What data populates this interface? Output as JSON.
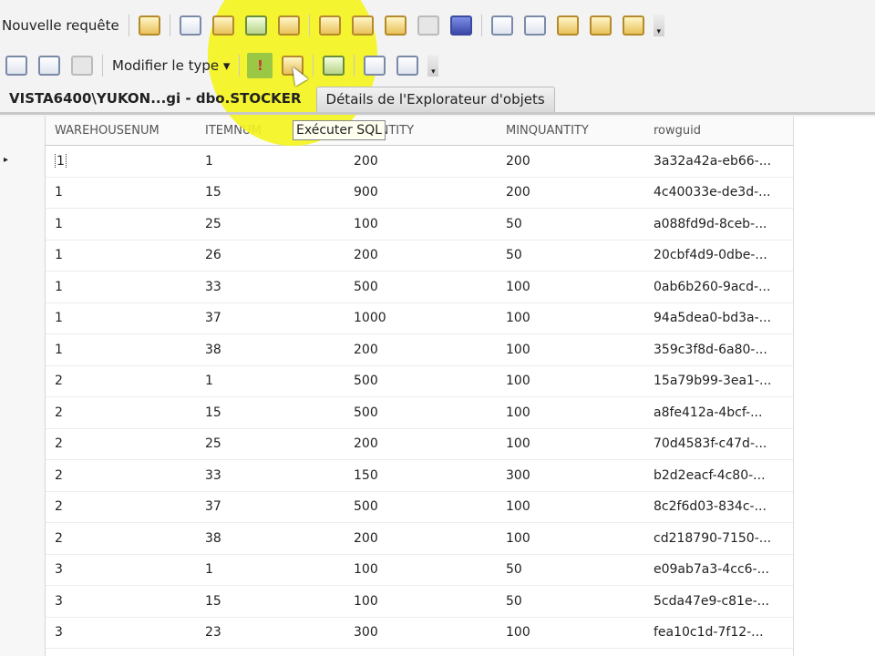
{
  "toolbar1": {
    "new_query_label": "Nouvelle requête",
    "more": "▾"
  },
  "toolbar2": {
    "change_type_label": "Modifier le type ▾",
    "execute_icon": "!",
    "more": "▾"
  },
  "tooltip": "Exécuter SQL",
  "tabs": [
    {
      "label": "VISTA6400\\YUKON...gi - dbo.STOCKER"
    },
    {
      "label": "Détails de l'Explorateur d'objets"
    }
  ],
  "grid": {
    "columns": [
      "WAREHOUSENUM",
      "ITEMNUM",
      "QUANTITY",
      "MINQUANTITY",
      "rowguid"
    ],
    "row_pointer": "▸",
    "rows": [
      [
        "1",
        "1",
        "200",
        "200",
        "3a32a42a-eb66-..."
      ],
      [
        "1",
        "15",
        "900",
        "200",
        "4c40033e-de3d-..."
      ],
      [
        "1",
        "25",
        "100",
        "50",
        "a088fd9d-8ceb-..."
      ],
      [
        "1",
        "26",
        "200",
        "50",
        "20cbf4d9-0dbe-..."
      ],
      [
        "1",
        "33",
        "500",
        "100",
        "0ab6b260-9acd-..."
      ],
      [
        "1",
        "37",
        "1000",
        "100",
        "94a5dea0-bd3a-..."
      ],
      [
        "1",
        "38",
        "200",
        "100",
        "359c3f8d-6a80-..."
      ],
      [
        "2",
        "1",
        "500",
        "100",
        "15a79b99-3ea1-..."
      ],
      [
        "2",
        "15",
        "500",
        "100",
        "a8fe412a-4bcf-..."
      ],
      [
        "2",
        "25",
        "200",
        "100",
        "70d4583f-c47d-..."
      ],
      [
        "2",
        "33",
        "150",
        "300",
        "b2d2eacf-4c80-..."
      ],
      [
        "2",
        "37",
        "500",
        "100",
        "8c2f6d03-834c-..."
      ],
      [
        "2",
        "38",
        "200",
        "100",
        "cd218790-7150-..."
      ],
      [
        "3",
        "1",
        "100",
        "50",
        "e09ab7a3-4cc6-..."
      ],
      [
        "3",
        "15",
        "100",
        "50",
        "5cda47e9-c81e-..."
      ],
      [
        "3",
        "23",
        "300",
        "100",
        "fea10c1d-7f12-..."
      ]
    ]
  }
}
